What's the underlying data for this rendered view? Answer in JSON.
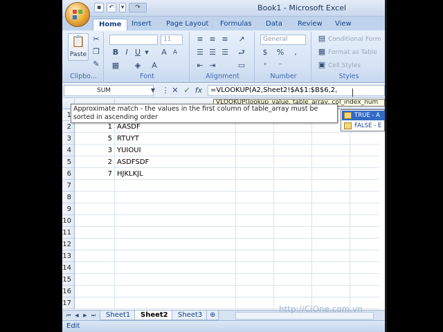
{
  "window": {
    "title": "Book1 - Microsoft Excel"
  },
  "tabs": [
    {
      "label": "Home"
    },
    {
      "label": "Insert"
    },
    {
      "label": "Page Layout"
    },
    {
      "label": "Formulas"
    },
    {
      "label": "Data"
    },
    {
      "label": "Review"
    },
    {
      "label": "View"
    }
  ],
  "ribbon": {
    "clipboard": {
      "label": "Clipbo...",
      "paste": "Paste"
    },
    "font": {
      "label": "Font",
      "size": "11"
    },
    "alignment": {
      "label": "Alignment"
    },
    "number": {
      "label": "Number",
      "format": "General",
      "percent": "%"
    },
    "styles": {
      "label": "Styles",
      "conditional": "Conditional Form",
      "format_table": "Format as Table",
      "cell_styles": "Cell Styles"
    }
  },
  "formula_bar": {
    "name_box": "SUM",
    "formula": "=VLOOKUP(A2,Sheet2!$A$1:$B$6,2,"
  },
  "tooltip": {
    "args": "VLOOKUP(lookup_value, table_array, col_index_num",
    "hint": "Approximate match - the values in the first column of table_array must be sorted in ascending order"
  },
  "autocomplete": [
    {
      "label": "TRUE - A"
    },
    {
      "label": "FALSE - E"
    }
  ],
  "rows": [
    {
      "num": "1",
      "a": "",
      "b": ""
    },
    {
      "num": "2",
      "a": "1",
      "b": "AASDF"
    },
    {
      "num": "3",
      "a": "5",
      "b": "RTUYT"
    },
    {
      "num": "4",
      "a": "3",
      "b": "YUIOUI"
    },
    {
      "num": "5",
      "a": "2",
      "b": "ASDFSDF"
    },
    {
      "num": "6",
      "a": "7",
      "b": "HJKLKJL"
    },
    {
      "num": "7",
      "a": "",
      "b": ""
    },
    {
      "num": "8",
      "a": "",
      "b": ""
    },
    {
      "num": "9",
      "a": "",
      "b": ""
    },
    {
      "num": "10",
      "a": "",
      "b": ""
    },
    {
      "num": "11",
      "a": "",
      "b": ""
    },
    {
      "num": "12",
      "a": "",
      "b": ""
    },
    {
      "num": "13",
      "a": "",
      "b": ""
    },
    {
      "num": "14",
      "a": "",
      "b": ""
    },
    {
      "num": "15",
      "a": "",
      "b": ""
    },
    {
      "num": "16",
      "a": "",
      "b": ""
    },
    {
      "num": "17",
      "a": "",
      "b": ""
    }
  ],
  "sheets": [
    {
      "label": "Sheet1"
    },
    {
      "label": "Sheet2"
    },
    {
      "label": "Sheet3"
    }
  ],
  "status": {
    "mode": "Edit"
  },
  "watermark": "http://CiOne.com.vn",
  "colors": {
    "accent": "#15428b",
    "selection": "#3169c6",
    "ribbon": "#d5e3f4"
  }
}
